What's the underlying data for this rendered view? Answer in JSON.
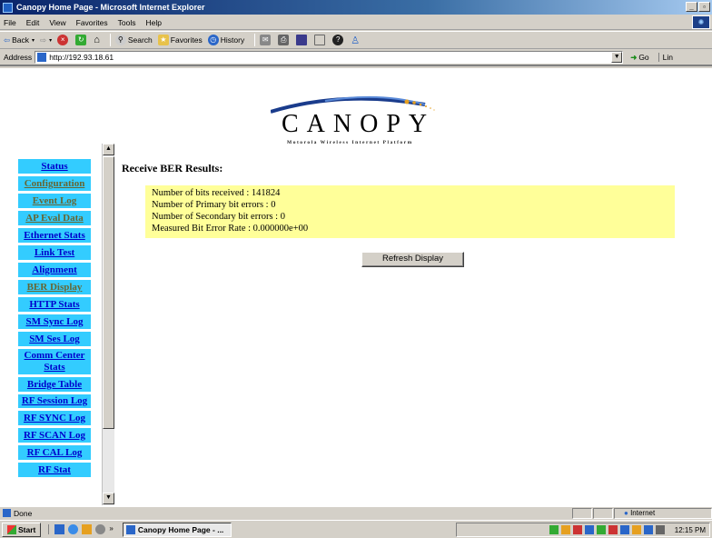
{
  "window": {
    "title": "Canopy Home Page - Microsoft Internet Explorer"
  },
  "menu": [
    "File",
    "Edit",
    "View",
    "Favorites",
    "Tools",
    "Help"
  ],
  "toolbar": {
    "back": "Back",
    "search": "Search",
    "favorites": "Favorites",
    "history": "History"
  },
  "address": {
    "label": "Address",
    "url": "http://192.93.18.61",
    "go": "Go",
    "links": "Lin"
  },
  "logo": {
    "word": "CANOPY",
    "tagline": "Motorola Wireless Internet Platform"
  },
  "sidebar": {
    "items": [
      {
        "label": "Status",
        "visited": false
      },
      {
        "label": "Configuration",
        "visited": true
      },
      {
        "label": "Event Log",
        "visited": true
      },
      {
        "label": "AP Eval Data",
        "visited": true
      },
      {
        "label": "Ethernet Stats",
        "visited": false
      },
      {
        "label": "Link Test",
        "visited": false
      },
      {
        "label": "Alignment",
        "visited": false
      },
      {
        "label": "BER Display",
        "visited": true
      },
      {
        "label": "HTTP Stats",
        "visited": false
      },
      {
        "label": "SM Sync Log",
        "visited": false
      },
      {
        "label": "SM Ses Log",
        "visited": false
      },
      {
        "label": "Comm Center Stats",
        "visited": false
      },
      {
        "label": "Bridge Table",
        "visited": false
      },
      {
        "label": "RF Session Log",
        "visited": false
      },
      {
        "label": "RF SYNC Log",
        "visited": false
      },
      {
        "label": "RF SCAN Log",
        "visited": false
      },
      {
        "label": "RF CAL Log",
        "visited": false
      },
      {
        "label": "RF Stat",
        "visited": false
      }
    ]
  },
  "main": {
    "title": "Receive BER Results:",
    "lines": [
      "Number of bits received : 141824",
      "Number of Primary bit errors : 0",
      "Number of Secondary bit errors : 0",
      "Measured Bit Error Rate : 0.000000e+00"
    ],
    "refresh_label": "Refresh Display"
  },
  "status": {
    "text": "Done",
    "zone": "Internet"
  },
  "taskbar": {
    "start": "Start",
    "task": "Canopy Home Page - ...",
    "clock": "12:15 PM"
  }
}
